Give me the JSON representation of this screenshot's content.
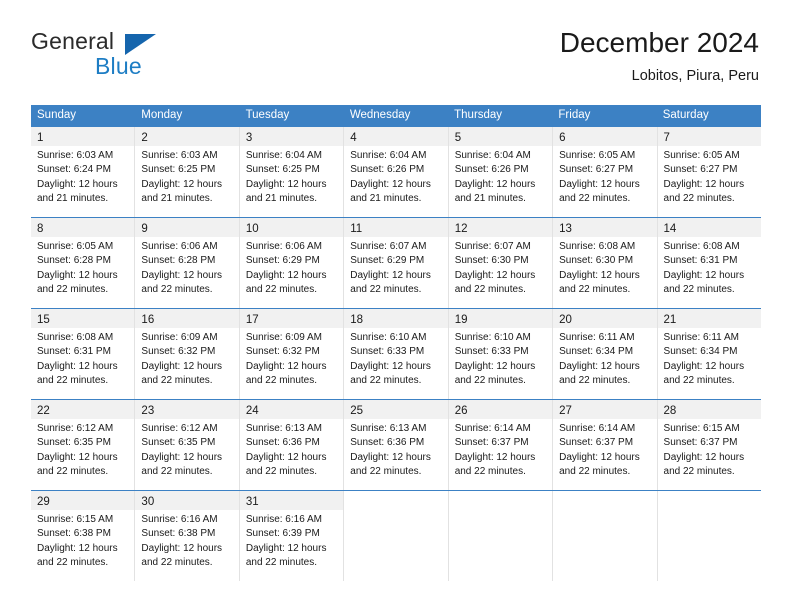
{
  "logo": {
    "word_one": "General",
    "word_two": "Blue",
    "triangle_color": "#1565ad",
    "blue_text_color": "#1d7dc4"
  },
  "header": {
    "title": "December 2024",
    "location": "Lobitos, Piura, Peru"
  },
  "theme": {
    "header_blue": "#3c81c4",
    "daynum_band": "#f1f1f1",
    "cell_divider": "#e2e2e2",
    "text": "#1a1a1a"
  },
  "weekdays": [
    "Sunday",
    "Monday",
    "Tuesday",
    "Wednesday",
    "Thursday",
    "Friday",
    "Saturday"
  ],
  "weeks": [
    [
      {
        "day": "1",
        "lines": [
          "Sunrise: 6:03 AM",
          "Sunset: 6:24 PM",
          "Daylight: 12 hours",
          "and 21 minutes."
        ]
      },
      {
        "day": "2",
        "lines": [
          "Sunrise: 6:03 AM",
          "Sunset: 6:25 PM",
          "Daylight: 12 hours",
          "and 21 minutes."
        ]
      },
      {
        "day": "3",
        "lines": [
          "Sunrise: 6:04 AM",
          "Sunset: 6:25 PM",
          "Daylight: 12 hours",
          "and 21 minutes."
        ]
      },
      {
        "day": "4",
        "lines": [
          "Sunrise: 6:04 AM",
          "Sunset: 6:26 PM",
          "Daylight: 12 hours",
          "and 21 minutes."
        ]
      },
      {
        "day": "5",
        "lines": [
          "Sunrise: 6:04 AM",
          "Sunset: 6:26 PM",
          "Daylight: 12 hours",
          "and 21 minutes."
        ]
      },
      {
        "day": "6",
        "lines": [
          "Sunrise: 6:05 AM",
          "Sunset: 6:27 PM",
          "Daylight: 12 hours",
          "and 22 minutes."
        ]
      },
      {
        "day": "7",
        "lines": [
          "Sunrise: 6:05 AM",
          "Sunset: 6:27 PM",
          "Daylight: 12 hours",
          "and 22 minutes."
        ]
      }
    ],
    [
      {
        "day": "8",
        "lines": [
          "Sunrise: 6:05 AM",
          "Sunset: 6:28 PM",
          "Daylight: 12 hours",
          "and 22 minutes."
        ]
      },
      {
        "day": "9",
        "lines": [
          "Sunrise: 6:06 AM",
          "Sunset: 6:28 PM",
          "Daylight: 12 hours",
          "and 22 minutes."
        ]
      },
      {
        "day": "10",
        "lines": [
          "Sunrise: 6:06 AM",
          "Sunset: 6:29 PM",
          "Daylight: 12 hours",
          "and 22 minutes."
        ]
      },
      {
        "day": "11",
        "lines": [
          "Sunrise: 6:07 AM",
          "Sunset: 6:29 PM",
          "Daylight: 12 hours",
          "and 22 minutes."
        ]
      },
      {
        "day": "12",
        "lines": [
          "Sunrise: 6:07 AM",
          "Sunset: 6:30 PM",
          "Daylight: 12 hours",
          "and 22 minutes."
        ]
      },
      {
        "day": "13",
        "lines": [
          "Sunrise: 6:08 AM",
          "Sunset: 6:30 PM",
          "Daylight: 12 hours",
          "and 22 minutes."
        ]
      },
      {
        "day": "14",
        "lines": [
          "Sunrise: 6:08 AM",
          "Sunset: 6:31 PM",
          "Daylight: 12 hours",
          "and 22 minutes."
        ]
      }
    ],
    [
      {
        "day": "15",
        "lines": [
          "Sunrise: 6:08 AM",
          "Sunset: 6:31 PM",
          "Daylight: 12 hours",
          "and 22 minutes."
        ]
      },
      {
        "day": "16",
        "lines": [
          "Sunrise: 6:09 AM",
          "Sunset: 6:32 PM",
          "Daylight: 12 hours",
          "and 22 minutes."
        ]
      },
      {
        "day": "17",
        "lines": [
          "Sunrise: 6:09 AM",
          "Sunset: 6:32 PM",
          "Daylight: 12 hours",
          "and 22 minutes."
        ]
      },
      {
        "day": "18",
        "lines": [
          "Sunrise: 6:10 AM",
          "Sunset: 6:33 PM",
          "Daylight: 12 hours",
          "and 22 minutes."
        ]
      },
      {
        "day": "19",
        "lines": [
          "Sunrise: 6:10 AM",
          "Sunset: 6:33 PM",
          "Daylight: 12 hours",
          "and 22 minutes."
        ]
      },
      {
        "day": "20",
        "lines": [
          "Sunrise: 6:11 AM",
          "Sunset: 6:34 PM",
          "Daylight: 12 hours",
          "and 22 minutes."
        ]
      },
      {
        "day": "21",
        "lines": [
          "Sunrise: 6:11 AM",
          "Sunset: 6:34 PM",
          "Daylight: 12 hours",
          "and 22 minutes."
        ]
      }
    ],
    [
      {
        "day": "22",
        "lines": [
          "Sunrise: 6:12 AM",
          "Sunset: 6:35 PM",
          "Daylight: 12 hours",
          "and 22 minutes."
        ]
      },
      {
        "day": "23",
        "lines": [
          "Sunrise: 6:12 AM",
          "Sunset: 6:35 PM",
          "Daylight: 12 hours",
          "and 22 minutes."
        ]
      },
      {
        "day": "24",
        "lines": [
          "Sunrise: 6:13 AM",
          "Sunset: 6:36 PM",
          "Daylight: 12 hours",
          "and 22 minutes."
        ]
      },
      {
        "day": "25",
        "lines": [
          "Sunrise: 6:13 AM",
          "Sunset: 6:36 PM",
          "Daylight: 12 hours",
          "and 22 minutes."
        ]
      },
      {
        "day": "26",
        "lines": [
          "Sunrise: 6:14 AM",
          "Sunset: 6:37 PM",
          "Daylight: 12 hours",
          "and 22 minutes."
        ]
      },
      {
        "day": "27",
        "lines": [
          "Sunrise: 6:14 AM",
          "Sunset: 6:37 PM",
          "Daylight: 12 hours",
          "and 22 minutes."
        ]
      },
      {
        "day": "28",
        "lines": [
          "Sunrise: 6:15 AM",
          "Sunset: 6:37 PM",
          "Daylight: 12 hours",
          "and 22 minutes."
        ]
      }
    ],
    [
      {
        "day": "29",
        "lines": [
          "Sunrise: 6:15 AM",
          "Sunset: 6:38 PM",
          "Daylight: 12 hours",
          "and 22 minutes."
        ]
      },
      {
        "day": "30",
        "lines": [
          "Sunrise: 6:16 AM",
          "Sunset: 6:38 PM",
          "Daylight: 12 hours",
          "and 22 minutes."
        ]
      },
      {
        "day": "31",
        "lines": [
          "Sunrise: 6:16 AM",
          "Sunset: 6:39 PM",
          "Daylight: 12 hours",
          "and 22 minutes."
        ]
      },
      {
        "day": "",
        "lines": []
      },
      {
        "day": "",
        "lines": []
      },
      {
        "day": "",
        "lines": []
      },
      {
        "day": "",
        "lines": []
      }
    ]
  ]
}
